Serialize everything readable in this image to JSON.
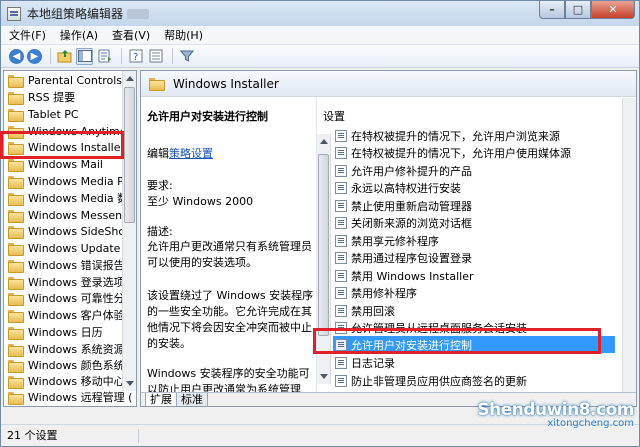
{
  "window": {
    "title": "本地组策略编辑器"
  },
  "menu": [
    "文件(F)",
    "操作(A)",
    "查看(V)",
    "帮助(H)"
  ],
  "tree": {
    "items": [
      {
        "label": "Parental Controls"
      },
      {
        "label": "RSS 提要"
      },
      {
        "label": "Tablet PC"
      },
      {
        "label": "Windows Anytime U"
      },
      {
        "label": "Windows Installer",
        "selected": true
      },
      {
        "label": "Windows Mail"
      },
      {
        "label": "Windows Media Pla"
      },
      {
        "label": "Windows Media 数"
      },
      {
        "label": "Windows Messenge"
      },
      {
        "label": "Windows SideShow"
      },
      {
        "label": "Windows Update"
      },
      {
        "label": "Windows 错误报告"
      },
      {
        "label": "Windows 登录选项"
      },
      {
        "label": "Windows 可靠性分析"
      },
      {
        "label": "Windows 客户体验改"
      },
      {
        "label": "Windows 日历"
      },
      {
        "label": "Windows 系统资源管"
      },
      {
        "label": "Windows 颜色系统"
      },
      {
        "label": "Windows 移动中心"
      },
      {
        "label": "Windows 远程管理 ("
      }
    ]
  },
  "right": {
    "header": "Windows Installer",
    "description": {
      "policy_title": "允许用户对安装进行控制",
      "edit_prefix": "编辑",
      "edit_link": "策略设置",
      "req_label": "要求:",
      "req_value": "至少 Windows 2000",
      "desc_label": "描述:",
      "desc_line1": "允许用户更改通常只有系统管理员",
      "desc_line2": "可以使用的安装选项。",
      "body_line1": "该设置绕过了 Windows 安装程序",
      "body_line2": "的一些安全功能。它允许完成在其",
      "body_line3": "他情况下将会因安全冲突而被中止",
      "body_line4": "的安装。",
      "body_line5": "Windows 安装程序的安全功能可",
      "body_line6": "以防止用户更改通常为系统管理"
    },
    "settings_header": "设置",
    "settings": [
      {
        "label": "在特权被提升的情况下，允许用户浏览来源"
      },
      {
        "label": "在特权被提升的情况下，允许用户使用媒体源"
      },
      {
        "label": "允许用户修补提升的产品"
      },
      {
        "label": "永远以高特权进行安装"
      },
      {
        "label": "禁止使用重新启动管理器"
      },
      {
        "label": "关闭新来源的浏览对话框"
      },
      {
        "label": "禁用享元修补程序"
      },
      {
        "label": "禁用通过程序包设置登录"
      },
      {
        "label": "禁用 Windows Installer"
      },
      {
        "label": "禁用修补程序"
      },
      {
        "label": "禁用回滚"
      },
      {
        "label": "允许管理员从远程桌面服务会话安装"
      },
      {
        "label": "允许用户对安装进行控制",
        "selected": true
      },
      {
        "label": "日志记录"
      },
      {
        "label": "防止非管理员应用供应商签名的更新"
      }
    ],
    "tabs": [
      "扩展",
      "标准"
    ]
  },
  "status": {
    "text": "21 个设置"
  },
  "watermark": {
    "main": "Shenduwin8.com",
    "sub": "xitongcheng.com"
  },
  "colors": {
    "highlight_box": "#e0202a",
    "selection": "#3399ff",
    "link": "#1a53b8"
  }
}
